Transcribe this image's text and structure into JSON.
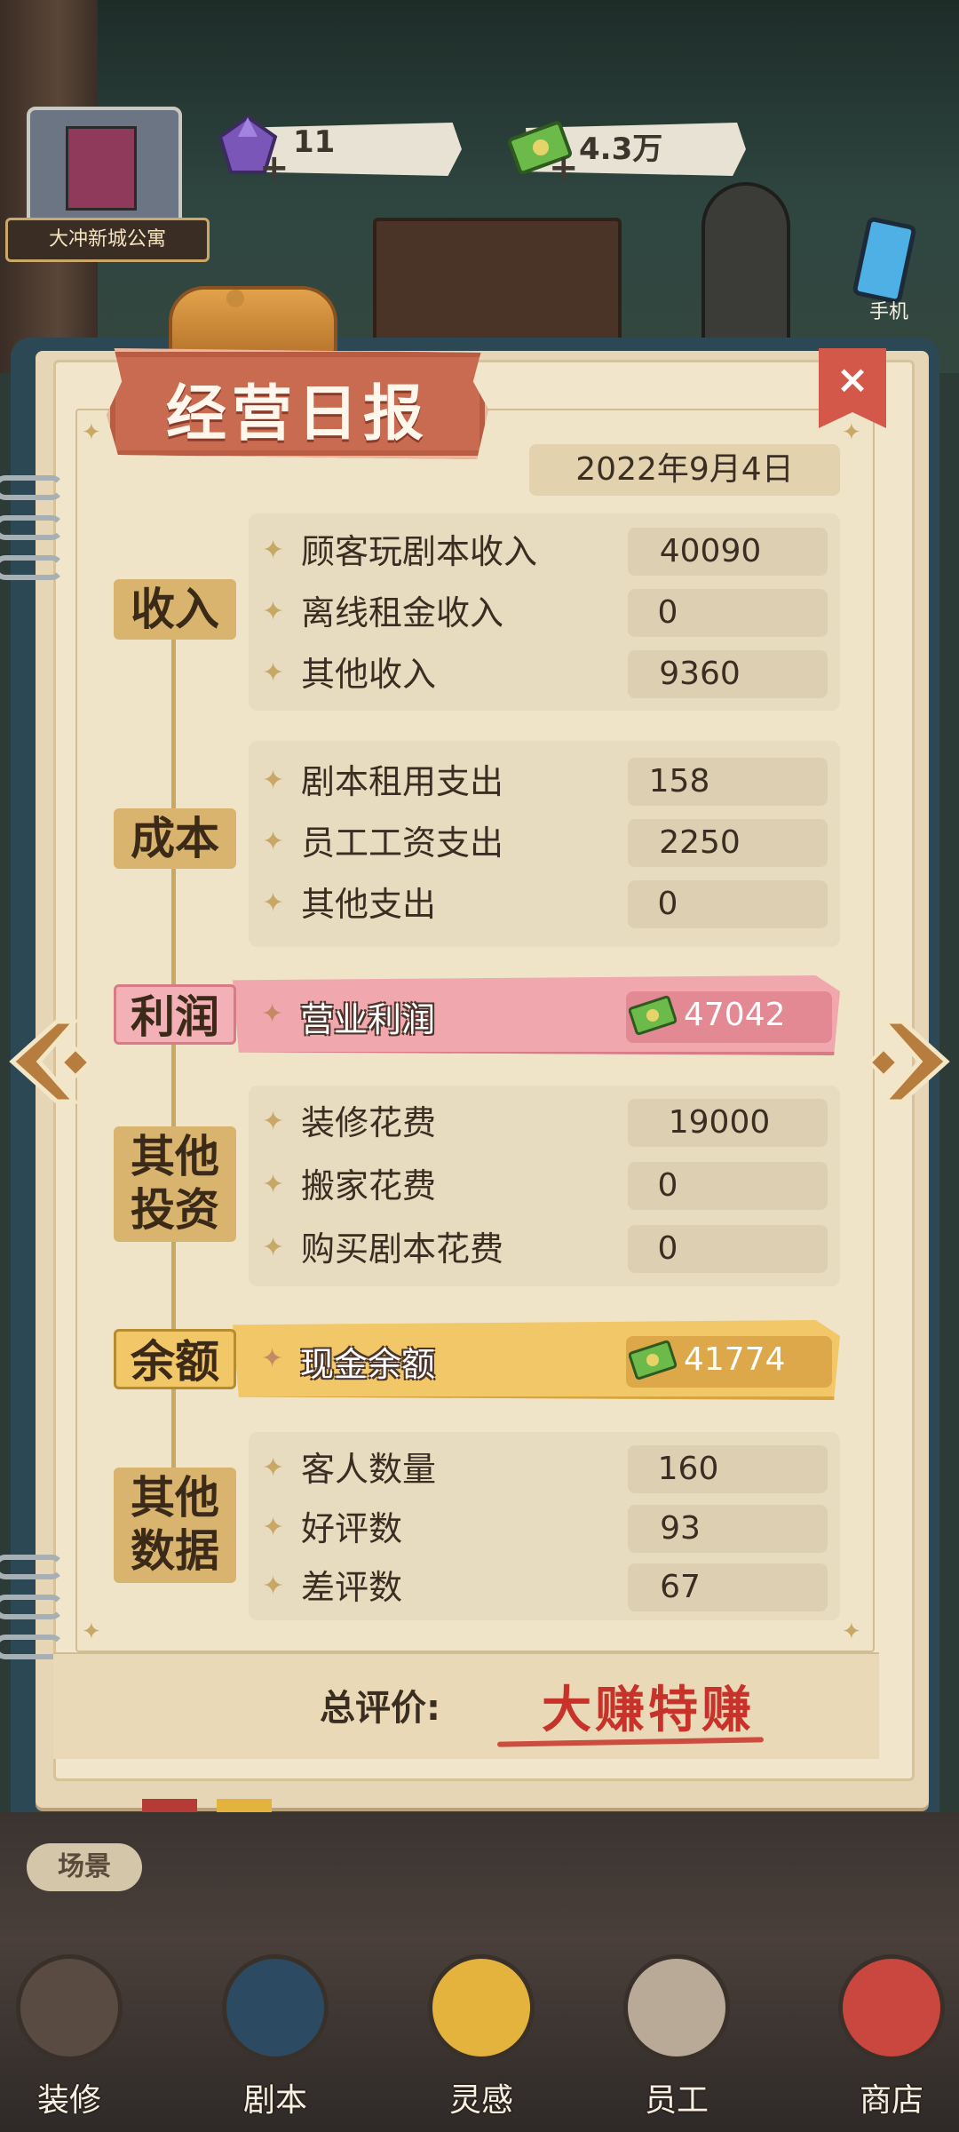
{
  "top_bar": {
    "location": "大冲新城公寓",
    "gem_count": "11",
    "cash_amount": "4.3万",
    "plus": "+",
    "phone_label": "手机"
  },
  "report": {
    "title": "经营日报",
    "close": "×",
    "date": "2022年9月4日",
    "sections": {
      "income": {
        "label": "收入",
        "rows": [
          {
            "label": "顾客玩剧本收入",
            "value": "40090"
          },
          {
            "label": "离线租金收入",
            "value": "0"
          },
          {
            "label": "其他收入",
            "value": "9360"
          }
        ]
      },
      "cost": {
        "label": "成本",
        "rows": [
          {
            "label": "剧本租用支出",
            "value": "158"
          },
          {
            "label": "员工工资支出",
            "value": "2250"
          },
          {
            "label": "其他支出",
            "value": "0"
          }
        ]
      },
      "profit": {
        "label": "利润",
        "item_label": "营业利润",
        "value": "47042"
      },
      "investment": {
        "label_line1": "其他",
        "label_line2": "投资",
        "rows": [
          {
            "label": "装修花费",
            "value": "19000"
          },
          {
            "label": "搬家花费",
            "value": "0"
          },
          {
            "label": "购买剧本花费",
            "value": "0"
          }
        ]
      },
      "balance": {
        "label": "余额",
        "item_label": "现金余额",
        "value": "41774"
      },
      "other_data": {
        "label_line1": "其他",
        "label_line2": "数据",
        "rows": [
          {
            "label": "客人数量",
            "value": "160"
          },
          {
            "label": "好评数",
            "value": "93"
          },
          {
            "label": "差评数",
            "value": "67"
          }
        ]
      }
    },
    "rating_label": "总评价:",
    "rating_value": "大赚特赚"
  },
  "bottom_nav": {
    "scene": "场景",
    "items": [
      {
        "label": "装修"
      },
      {
        "label": "剧本"
      },
      {
        "label": "灵感"
      },
      {
        "label": "员工"
      },
      {
        "label": "商店"
      }
    ]
  },
  "colors": {
    "panel_frame": "#2d4855",
    "title_banner": "#c86b50",
    "profit_band": "#f0a7ae",
    "balance_band": "#f2c767",
    "rating_red": "#c7332b",
    "category_gold": "#d8b46e"
  }
}
